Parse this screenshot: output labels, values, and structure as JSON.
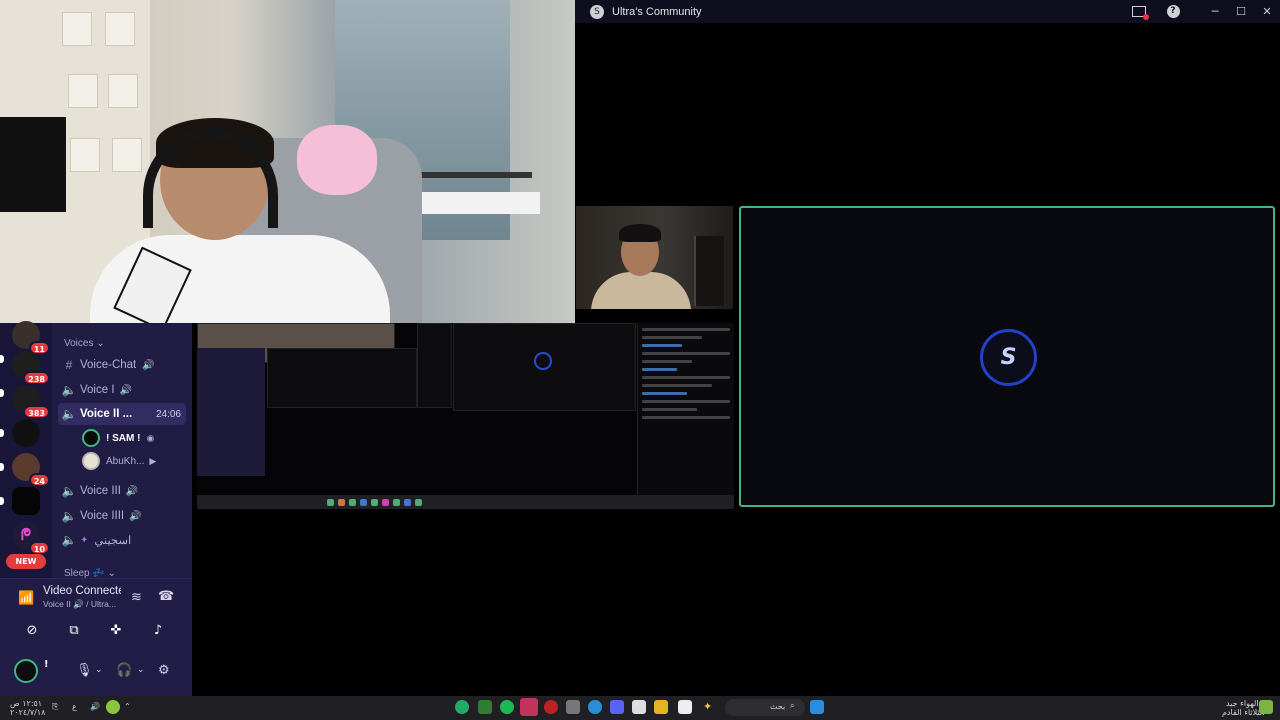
{
  "window": {
    "title": "Ultra's Community"
  },
  "servers": [
    {
      "badge": "11"
    },
    {
      "badge": "238"
    },
    {
      "badge": "383"
    },
    {
      "badge": ""
    },
    {
      "badge": "24"
    },
    {
      "badge": ""
    },
    {
      "badge": "10"
    }
  ],
  "new_label": "NEW",
  "channels": {
    "voices_category": "Voices",
    "items": [
      {
        "name": "Voice-Chat",
        "type": "text"
      },
      {
        "name": "Voice I",
        "type": "voice"
      },
      {
        "name": "Voice II ...",
        "type": "voice",
        "active": true,
        "time": "24:06"
      },
      {
        "name": "Voice III",
        "type": "voice"
      },
      {
        "name": "Voice IIII",
        "type": "voice"
      },
      {
        "name": "اسجيني",
        "type": "voice"
      }
    ],
    "voice_users": [
      {
        "name": "! SAM !"
      },
      {
        "name": "AbuKh..."
      }
    ],
    "sleep_category": "Sleep"
  },
  "voice_panel": {
    "status": "Video Connected",
    "location": "Voice II 🔊 / Ultra...",
    "user_short": "!"
  },
  "taskbar": {
    "search_text": "بحث",
    "weather_line1": "الهواء جيد",
    "weather_line2": "الثلاثاء القادم",
    "clock_time": "١٢:٥١ ص",
    "clock_date": "٢٠٢٤/٧/١٨"
  },
  "colors": {
    "accent_green": "#43b581",
    "badge_red": "#e23c3c",
    "rail_bg": "#1a163a",
    "channel_bg": "#211c44",
    "logo_blue": "#2342c9"
  },
  "icons": [
    "hash-icon",
    "speaker-icon",
    "signal-icon",
    "phone-hangup-icon",
    "video-off-icon",
    "screen-share-icon",
    "activity-icon",
    "soundboard-icon",
    "microphone-icon",
    "headphones-icon",
    "gear-icon",
    "help-icon",
    "minimize-icon",
    "maximize-icon",
    "close-icon"
  ]
}
